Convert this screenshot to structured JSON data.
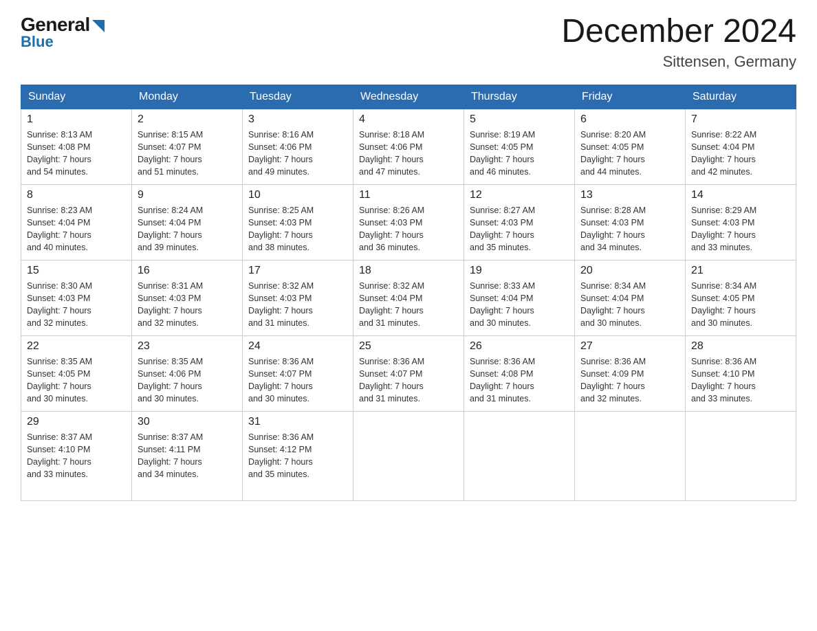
{
  "logo": {
    "general": "General",
    "blue": "Blue"
  },
  "title": "December 2024",
  "location": "Sittensen, Germany",
  "days_of_week": [
    "Sunday",
    "Monday",
    "Tuesday",
    "Wednesday",
    "Thursday",
    "Friday",
    "Saturday"
  ],
  "weeks": [
    [
      {
        "day": "1",
        "sunrise": "8:13 AM",
        "sunset": "4:08 PM",
        "daylight": "7 hours and 54 minutes."
      },
      {
        "day": "2",
        "sunrise": "8:15 AM",
        "sunset": "4:07 PM",
        "daylight": "7 hours and 51 minutes."
      },
      {
        "day": "3",
        "sunrise": "8:16 AM",
        "sunset": "4:06 PM",
        "daylight": "7 hours and 49 minutes."
      },
      {
        "day": "4",
        "sunrise": "8:18 AM",
        "sunset": "4:06 PM",
        "daylight": "7 hours and 47 minutes."
      },
      {
        "day": "5",
        "sunrise": "8:19 AM",
        "sunset": "4:05 PM",
        "daylight": "7 hours and 46 minutes."
      },
      {
        "day": "6",
        "sunrise": "8:20 AM",
        "sunset": "4:05 PM",
        "daylight": "7 hours and 44 minutes."
      },
      {
        "day": "7",
        "sunrise": "8:22 AM",
        "sunset": "4:04 PM",
        "daylight": "7 hours and 42 minutes."
      }
    ],
    [
      {
        "day": "8",
        "sunrise": "8:23 AM",
        "sunset": "4:04 PM",
        "daylight": "7 hours and 40 minutes."
      },
      {
        "day": "9",
        "sunrise": "8:24 AM",
        "sunset": "4:04 PM",
        "daylight": "7 hours and 39 minutes."
      },
      {
        "day": "10",
        "sunrise": "8:25 AM",
        "sunset": "4:03 PM",
        "daylight": "7 hours and 38 minutes."
      },
      {
        "day": "11",
        "sunrise": "8:26 AM",
        "sunset": "4:03 PM",
        "daylight": "7 hours and 36 minutes."
      },
      {
        "day": "12",
        "sunrise": "8:27 AM",
        "sunset": "4:03 PM",
        "daylight": "7 hours and 35 minutes."
      },
      {
        "day": "13",
        "sunrise": "8:28 AM",
        "sunset": "4:03 PM",
        "daylight": "7 hours and 34 minutes."
      },
      {
        "day": "14",
        "sunrise": "8:29 AM",
        "sunset": "4:03 PM",
        "daylight": "7 hours and 33 minutes."
      }
    ],
    [
      {
        "day": "15",
        "sunrise": "8:30 AM",
        "sunset": "4:03 PM",
        "daylight": "7 hours and 32 minutes."
      },
      {
        "day": "16",
        "sunrise": "8:31 AM",
        "sunset": "4:03 PM",
        "daylight": "7 hours and 32 minutes."
      },
      {
        "day": "17",
        "sunrise": "8:32 AM",
        "sunset": "4:03 PM",
        "daylight": "7 hours and 31 minutes."
      },
      {
        "day": "18",
        "sunrise": "8:32 AM",
        "sunset": "4:04 PM",
        "daylight": "7 hours and 31 minutes."
      },
      {
        "day": "19",
        "sunrise": "8:33 AM",
        "sunset": "4:04 PM",
        "daylight": "7 hours and 30 minutes."
      },
      {
        "day": "20",
        "sunrise": "8:34 AM",
        "sunset": "4:04 PM",
        "daylight": "7 hours and 30 minutes."
      },
      {
        "day": "21",
        "sunrise": "8:34 AM",
        "sunset": "4:05 PM",
        "daylight": "7 hours and 30 minutes."
      }
    ],
    [
      {
        "day": "22",
        "sunrise": "8:35 AM",
        "sunset": "4:05 PM",
        "daylight": "7 hours and 30 minutes."
      },
      {
        "day": "23",
        "sunrise": "8:35 AM",
        "sunset": "4:06 PM",
        "daylight": "7 hours and 30 minutes."
      },
      {
        "day": "24",
        "sunrise": "8:36 AM",
        "sunset": "4:07 PM",
        "daylight": "7 hours and 30 minutes."
      },
      {
        "day": "25",
        "sunrise": "8:36 AM",
        "sunset": "4:07 PM",
        "daylight": "7 hours and 31 minutes."
      },
      {
        "day": "26",
        "sunrise": "8:36 AM",
        "sunset": "4:08 PM",
        "daylight": "7 hours and 31 minutes."
      },
      {
        "day": "27",
        "sunrise": "8:36 AM",
        "sunset": "4:09 PM",
        "daylight": "7 hours and 32 minutes."
      },
      {
        "day": "28",
        "sunrise": "8:36 AM",
        "sunset": "4:10 PM",
        "daylight": "7 hours and 33 minutes."
      }
    ],
    [
      {
        "day": "29",
        "sunrise": "8:37 AM",
        "sunset": "4:10 PM",
        "daylight": "7 hours and 33 minutes."
      },
      {
        "day": "30",
        "sunrise": "8:37 AM",
        "sunset": "4:11 PM",
        "daylight": "7 hours and 34 minutes."
      },
      {
        "day": "31",
        "sunrise": "8:36 AM",
        "sunset": "4:12 PM",
        "daylight": "7 hours and 35 minutes."
      },
      null,
      null,
      null,
      null
    ]
  ],
  "labels": {
    "sunrise": "Sunrise:",
    "sunset": "Sunset:",
    "daylight": "Daylight:"
  }
}
